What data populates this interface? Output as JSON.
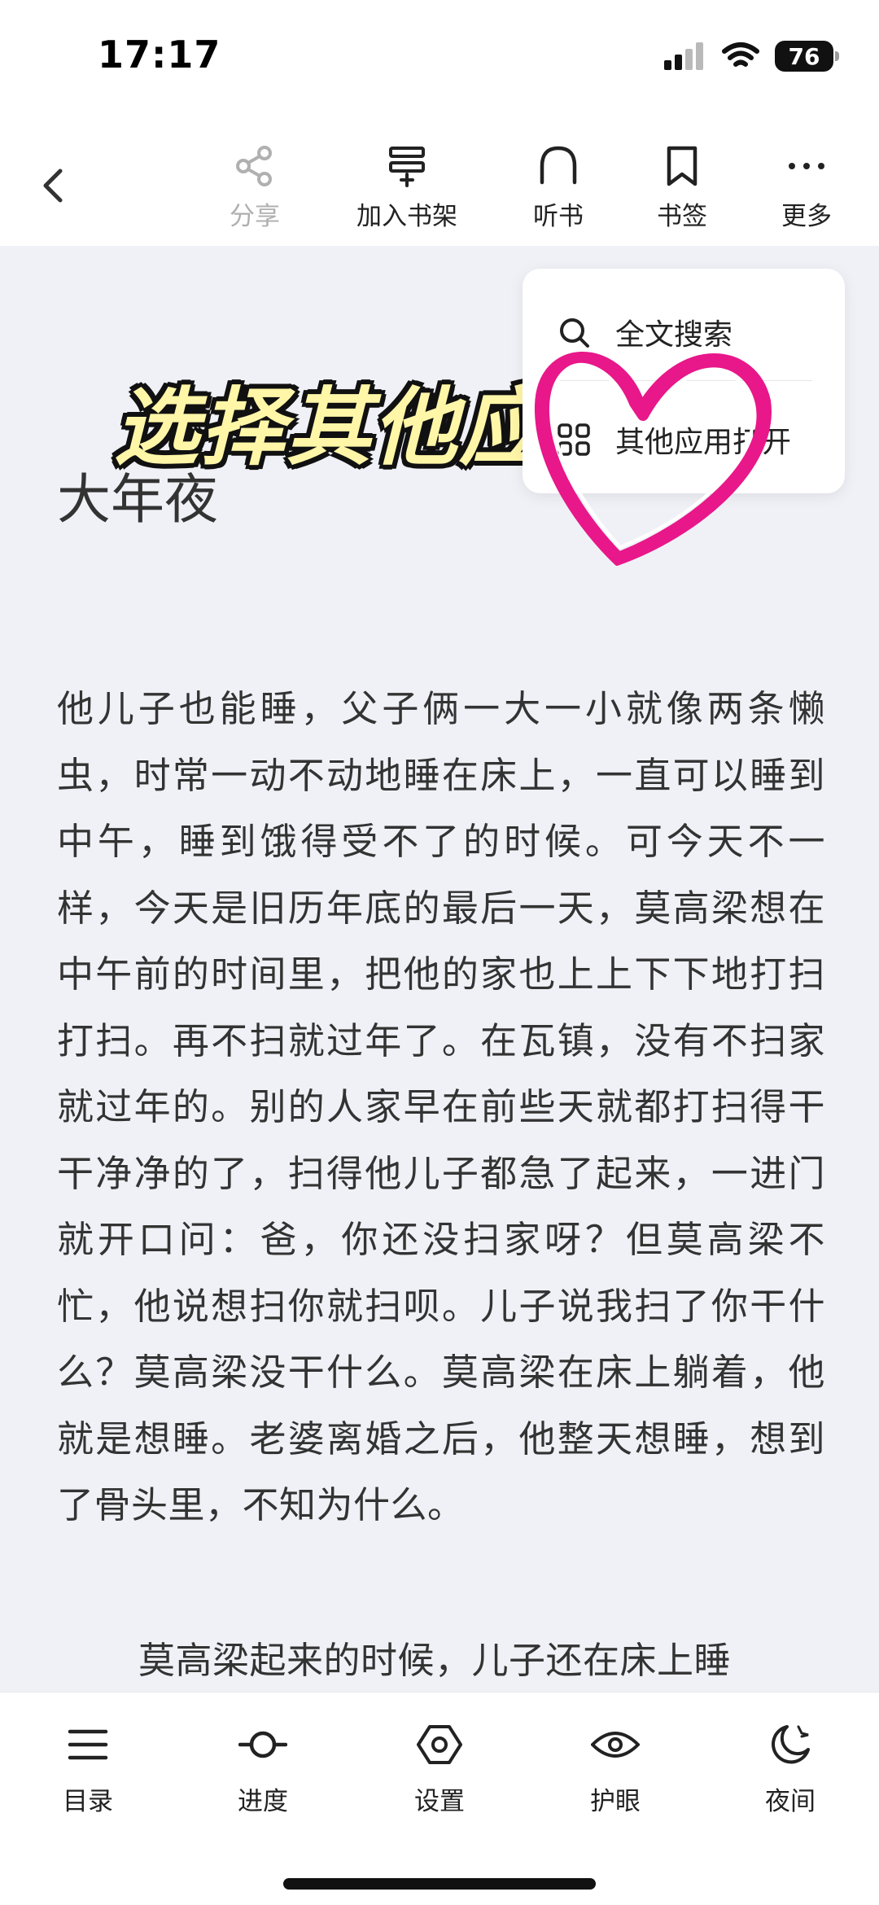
{
  "status": {
    "time": "17:17",
    "battery": "76"
  },
  "toolbar": {
    "share": "分享",
    "add_shelf": "加入书架",
    "listen": "听书",
    "bookmark": "书签",
    "more": "更多"
  },
  "menu": {
    "search": "全文搜索",
    "open_other": "其他应用打开"
  },
  "chapter": {
    "title": "大年夜",
    "paragraph1": "他儿子也能睡，父子俩一大一小就像两条懒虫，时常一动不动地睡在床上，一直可以睡到中午，睡到饿得受不了的时候。可今天不一样，今天是旧历年底的最后一天，莫高梁想在中午前的时间里，把他的家也上上下下地打扫打扫。再不扫就过年了。在瓦镇，没有不扫家就过年的。别的人家早在前些天就都打扫得干干净净的了，扫得他儿子都急了起来，一进门就开口问：爸，你还没扫家呀？但莫高梁不忙，他说想扫你就扫呗。儿子说我扫了你干什么？莫高梁没干什么。莫高梁在床上躺着，他就是想睡。老婆离婚之后，他整天想睡，想到了骨头里，不知为什么。",
    "paragraph2": "莫高梁起来的时候，儿子还在床上睡"
  },
  "overlay": {
    "caption": "选择其他应用打开"
  },
  "bottom": {
    "toc": "目录",
    "progress": "进度",
    "settings": "设置",
    "eye_care": "护眼",
    "night": "夜间"
  }
}
